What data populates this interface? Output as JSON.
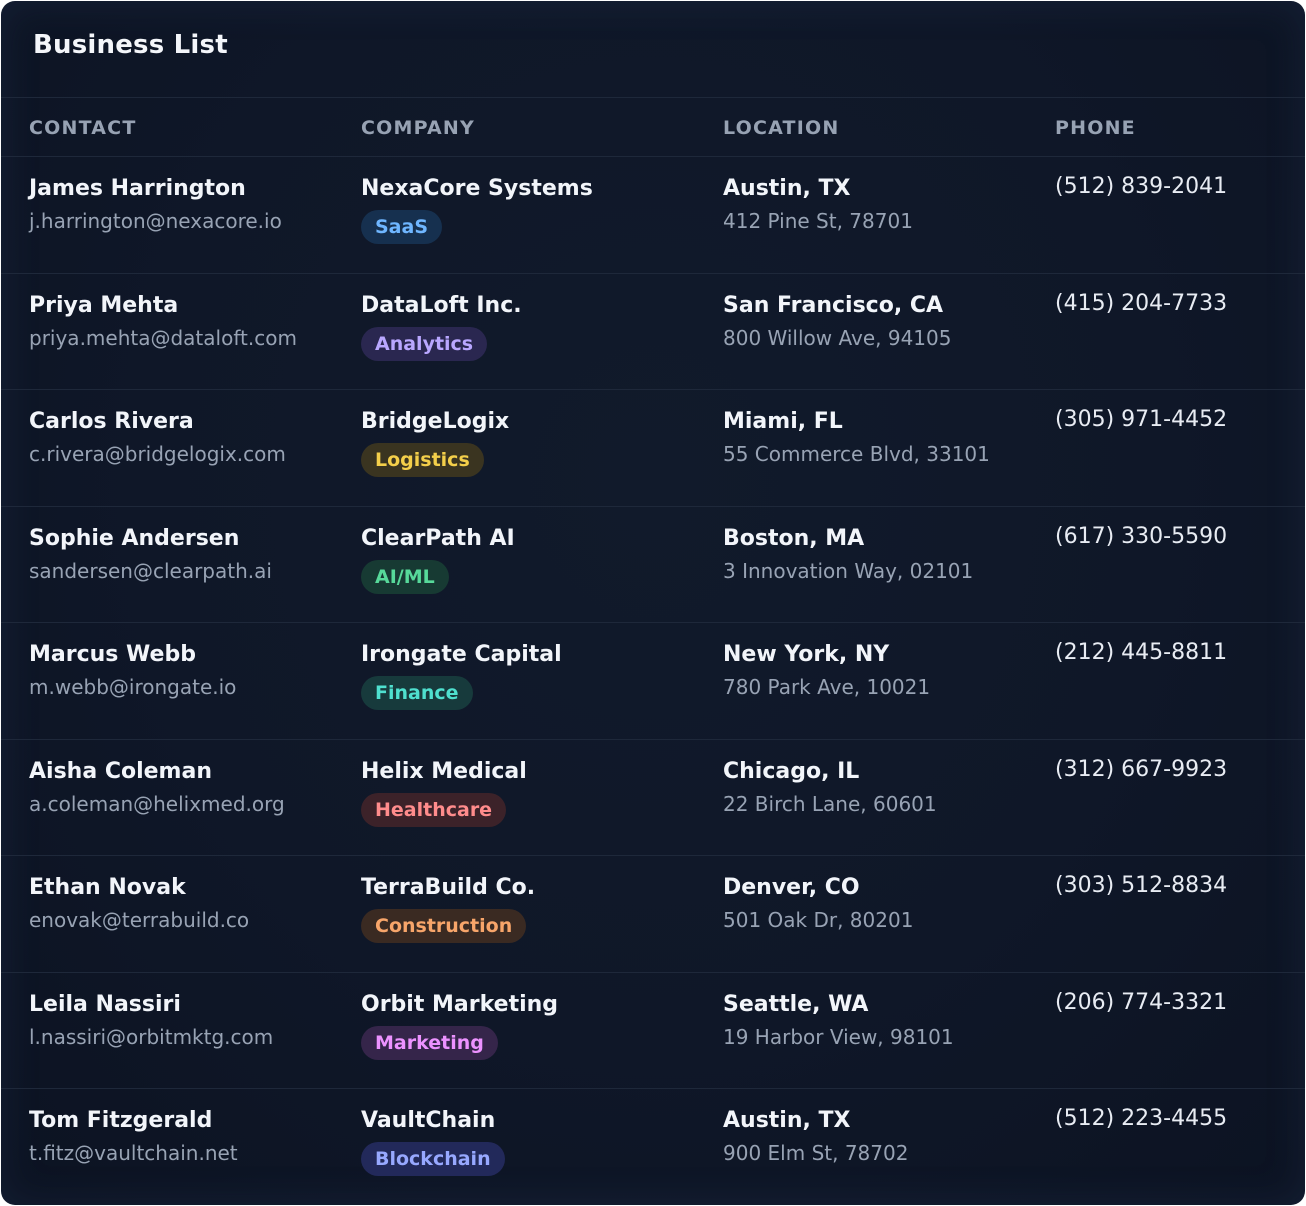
{
  "title": "Business List",
  "columns": {
    "contact": "CONTACT",
    "company": "COMPANY",
    "location": "LOCATION",
    "phone": "PHONE"
  },
  "rows": [
    {
      "name": "James Harrington",
      "email": "j.harrington@nexacore.io",
      "company": "NexaCore Systems",
      "tag": "SaaS",
      "tag_fg": "#6fb6ff",
      "tag_bg": "#16304f",
      "city": "Austin, TX",
      "address": "412 Pine St, 78701",
      "phone": "(512) 839-2041"
    },
    {
      "name": "Priya Mehta",
      "email": "priya.mehta@dataloft.com",
      "company": "DataLoft Inc.",
      "tag": "Analytics",
      "tag_fg": "#b9a7ff",
      "tag_bg": "#2a2750",
      "city": "San Francisco, CA",
      "address": "800 Willow Ave, 94105",
      "phone": "(415) 204-7733"
    },
    {
      "name": "Carlos Rivera",
      "email": "c.rivera@bridgelogix.com",
      "company": "BridgeLogix",
      "tag": "Logistics",
      "tag_fg": "#f4cf4a",
      "tag_bg": "#3a3420",
      "city": "Miami, FL",
      "address": "55 Commerce Blvd, 33101",
      "phone": "(305) 971-4452"
    },
    {
      "name": "Sophie Andersen",
      "email": "sandersen@clearpath.ai",
      "company": "ClearPath AI",
      "tag": "AI/ML",
      "tag_fg": "#57d99a",
      "tag_bg": "#173a33",
      "city": "Boston, MA",
      "address": "3 Innovation Way, 02101",
      "phone": "(617) 330-5590"
    },
    {
      "name": "Marcus Webb",
      "email": "m.webb@irongate.io",
      "company": "Irongate Capital",
      "tag": "Finance",
      "tag_fg": "#4fe0cf",
      "tag_bg": "#173a3c",
      "city": "New York, NY",
      "address": "780 Park Ave, 10021",
      "phone": "(212) 445-8811"
    },
    {
      "name": "Aisha Coleman",
      "email": "a.coleman@helixmed.org",
      "company": "Helix Medical",
      "tag": "Healthcare",
      "tag_fg": "#ff8c8c",
      "tag_bg": "#3c2229",
      "city": "Chicago, IL",
      "address": "22 Birch Lane, 60601",
      "phone": "(312) 667-9923"
    },
    {
      "name": "Ethan Novak",
      "email": "enovak@terrabuild.co",
      "company": "TerraBuild Co.",
      "tag": "Construction",
      "tag_fg": "#f7a56a",
      "tag_bg": "#3a2a22",
      "city": "Denver, CO",
      "address": "501 Oak Dr, 80201",
      "phone": "(303) 512-8834"
    },
    {
      "name": "Leila Nassiri",
      "email": "l.nassiri@orbitmktg.com",
      "company": "Orbit Marketing",
      "tag": "Marketing",
      "tag_fg": "#ec92ff",
      "tag_bg": "#35254a",
      "city": "Seattle, WA",
      "address": "19 Harbor View, 98101",
      "phone": "(206) 774-3321"
    },
    {
      "name": "Tom Fitzgerald",
      "email": "t.fitz@vaultchain.net",
      "company": "VaultChain",
      "tag": "Blockchain",
      "tag_fg": "#97a8ff",
      "tag_bg": "#22295a",
      "city": "Austin, TX",
      "address": "900 Elm St, 78702",
      "phone": "(512) 223-4455"
    }
  ]
}
